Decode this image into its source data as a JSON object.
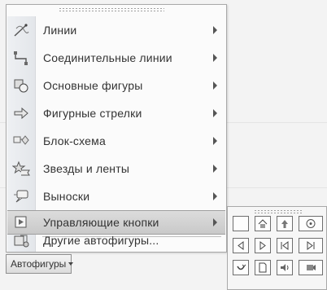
{
  "menu": {
    "items": [
      {
        "label": "Линии",
        "icon": "lines-icon",
        "has_submenu": true
      },
      {
        "label": "Соединительные линии",
        "icon": "connectors-icon",
        "has_submenu": true
      },
      {
        "label": "Основные фигуры",
        "icon": "basic-shapes-icon",
        "has_submenu": true
      },
      {
        "label": "Фигурные стрелки",
        "icon": "block-arrows-icon",
        "has_submenu": true
      },
      {
        "label": "Блок-схема",
        "icon": "flowchart-icon",
        "has_submenu": true
      },
      {
        "label": "Звезды и ленты",
        "icon": "stars-banners-icon",
        "has_submenu": true
      },
      {
        "label": "Выноски",
        "icon": "callouts-icon",
        "has_submenu": true
      },
      {
        "label": "Управляющие кнопки",
        "icon": "action-buttons-icon",
        "has_submenu": true,
        "highlighted": true
      },
      {
        "label": "Другие автофигуры...",
        "icon": "more-autoshapes-icon",
        "has_submenu": false
      }
    ]
  },
  "toolbar": {
    "autoshapes_label": "Автофигуры"
  },
  "submenu": {
    "buttons": [
      "action-button-custom-icon",
      "action-button-home-icon",
      "action-button-help-icon",
      "action-button-information-icon",
      "action-button-back-icon",
      "action-button-forward-icon",
      "action-button-beginning-icon",
      "action-button-end-icon",
      "action-button-return-icon",
      "action-button-document-icon",
      "action-button-sound-icon",
      "action-button-movie-icon"
    ]
  }
}
